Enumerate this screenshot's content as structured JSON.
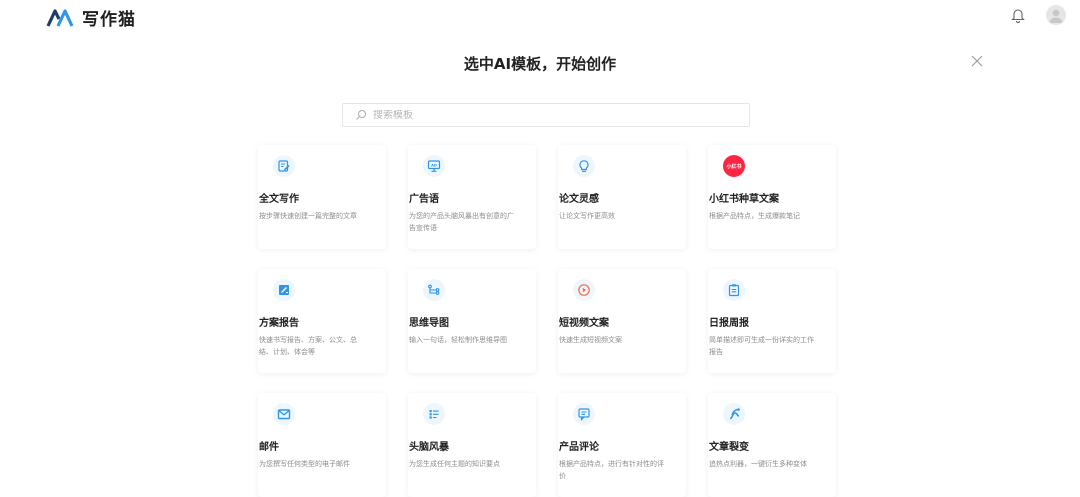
{
  "header": {
    "logo_text": "写作猫"
  },
  "dialog": {
    "title": "选中AI模板，开始创作",
    "search_placeholder": "搜索模板"
  },
  "cards": [
    {
      "title": "全文写作",
      "desc": "按步骤快速创建一篇完整的文章",
      "icon": "edit-doc-icon"
    },
    {
      "title": "广告语",
      "desc": "为您的产品头脑风暴出有创意的广告宣传语",
      "icon": "ad-monitor-icon"
    },
    {
      "title": "论文灵感",
      "desc": "让论文写作更高效",
      "icon": "lightbulb-icon"
    },
    {
      "title": "小红书种草文案",
      "desc": "根据产品特点，生成爆款笔记",
      "icon": "xiaohongshu-icon",
      "badge_text": "小红书"
    },
    {
      "title": "方案报告",
      "desc": "快速书写报告、方案、公文、总结、计划、体会等",
      "icon": "report-icon"
    },
    {
      "title": "思维导图",
      "desc": "输入一句话，轻松制作思维导图",
      "icon": "mindmap-icon"
    },
    {
      "title": "短视频文案",
      "desc": "快速生成短视频文案",
      "icon": "play-icon"
    },
    {
      "title": "日报周报",
      "desc": "简单描述即可生成一份详实的工作报告",
      "icon": "clipboard-icon"
    },
    {
      "title": "邮件",
      "desc": "为您撰写任何类型的电子邮件",
      "icon": "mail-icon"
    },
    {
      "title": "头脑风暴",
      "desc": "为您生成任何主题的知识要点",
      "icon": "list-icon"
    },
    {
      "title": "产品评论",
      "desc": "根据产品特点，进行有针对性的评价",
      "icon": "comment-icon"
    },
    {
      "title": "文章裂变",
      "desc": "追热点利器，一键衍生多种变体",
      "icon": "split-icon"
    }
  ],
  "colors": {
    "accent": "#2f95e8",
    "icon_bg": "#eef6fd",
    "xhs_red": "#ff2442"
  }
}
